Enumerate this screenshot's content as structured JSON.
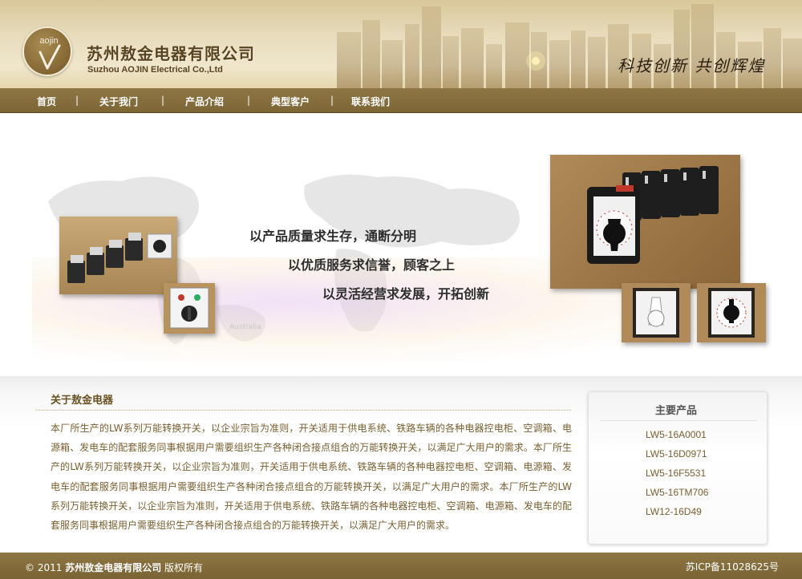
{
  "header": {
    "logo_text": "aojin",
    "company_cn": "苏州敖金电器有限公司",
    "company_en": "Suzhou AOJIN Electrical Co.,Ltd",
    "slogan": "科技创新 共创辉煌"
  },
  "nav": {
    "items": [
      "首页",
      "关于我门",
      "产品介绍",
      "典型客户",
      "联系我们"
    ],
    "separator": "|"
  },
  "banner": {
    "taglines": [
      "以产品质量求生存，通断分明",
      "以优质服务求信誉，顾客之上",
      "以灵活经营求发展，开拓创新"
    ],
    "map_labels": [
      "Australia"
    ]
  },
  "about": {
    "title": "关于敖金电器",
    "text": "本厂所生产的LW系列万能转换开关，以企业宗旨为准则，开关适用于供电系统、铁路车辆的各种电器控电柜、空调箱、电源箱、发电车的配套服务同事根据用户需要组织生产各种闭合接点组合的万能转换开关，以满足广大用户的需求。本厂所生产的LW系列万能转换开关，以企业宗旨为准则，开关适用于供电系统、铁路车辆的各种电器控电柜、空调箱、电源箱、发电车的配套服务同事根据用户需要组织生产各种闭合接点组合的万能转换开关，以满足广大用户的需求。本厂所生产的LW系列万能转换开关，以企业宗旨为准则，开关适用于供电系统、铁路车辆的各种电器控电柜、空调箱、电源箱、发电车的配套服务同事根据用户需要组织生产各种闭合接点组合的万能转换开关，以满足广大用户的需求。"
  },
  "products": {
    "title": "主要产品",
    "items": [
      "LW5-16A0001",
      "LW5-16D0971",
      "LW5-16F5531",
      "LW5-16TM706",
      "LW12-16D49"
    ]
  },
  "footer": {
    "copyright_prefix": "© 2011",
    "company": "苏州敖金电器有限公司",
    "rights": "版权所有",
    "icp": "苏ICP备11028625号"
  },
  "colors": {
    "brand_brown": "#8e7644",
    "header_beige": "#e8dcbc",
    "text_brown": "#7a5f30"
  }
}
